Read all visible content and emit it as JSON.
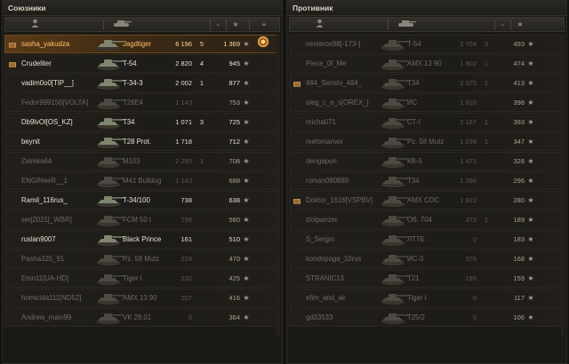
{
  "allies": {
    "title": "Союзники",
    "header": {
      "player_icon": "player-icon",
      "tank_icon": "tank-icon",
      "sort_icon": "sort-chevron-icon",
      "rating_icon": "star-icon",
      "extra_icon": "menu-icon"
    },
    "rows": [
      {
        "player": "sasha_yakudza",
        "tank": "Jagdtiger",
        "num1": "6 196",
        "num2": "5",
        "num3": "1 369",
        "star": "★",
        "clan_badge": true,
        "alive": true,
        "me": true,
        "extra": "achievement-icon"
      },
      {
        "player": "Crudeliter",
        "tank": "T-54",
        "num1": "2 820",
        "num2": "4",
        "num3": "945",
        "star": "★",
        "clan_badge": true,
        "alive": true
      },
      {
        "player": "vadim0o0[TIP__]",
        "tank": "T-34-3",
        "num1": "2 002",
        "num2": "1",
        "num3": "877",
        "star": "★",
        "alive": true
      },
      {
        "player": "Fedor999156[VOLTA]",
        "tank": "T26E4",
        "num1": "1 143",
        "num2": "",
        "num3": "753",
        "star": "★",
        "alive": false
      },
      {
        "player": "Db9lvOl[OS_KZ]",
        "tank": "T34",
        "num1": "1 071",
        "num2": "3",
        "num3": "725",
        "star": "★",
        "alive": true
      },
      {
        "player": "beynit",
        "tank": "T28 Prot.",
        "num1": "1 718",
        "num2": "",
        "num3": "712",
        "star": "★",
        "alive": true
      },
      {
        "player": "Zaimka64",
        "tank": "M103",
        "num1": "2 295",
        "num2": "1",
        "num3": "708",
        "star": "★",
        "alive": false
      },
      {
        "player": "ENGINeeR__1",
        "tank": "M41 Bulldog",
        "num1": "1 143",
        "num2": "",
        "num3": "688",
        "star": "★",
        "alive": false
      },
      {
        "player": "Ramil_116rus_",
        "tank": "T-34/100",
        "num1": "738",
        "num2": "",
        "num3": "638",
        "star": "★",
        "alive": true
      },
      {
        "player": "serj2021[_WBR]",
        "tank": "FCM 50 t",
        "num1": "756",
        "num2": "",
        "num3": "560",
        "star": "★",
        "alive": false
      },
      {
        "player": "ruslan9007",
        "tank": "Black Prince",
        "num1": "161",
        "num2": "",
        "num3": "510",
        "star": "★",
        "alive": true
      },
      {
        "player": "Pasha325_91",
        "tank": "Pz. 58 Mutz",
        "num1": "228",
        "num2": "",
        "num3": "470",
        "star": "★",
        "alive": false
      },
      {
        "player": "Emn11[UA-HD]",
        "tank": "Tiger I",
        "num1": "232",
        "num2": "",
        "num3": "425",
        "star": "★",
        "alive": false
      },
      {
        "player": "homicida111[ND52]",
        "tank": "AMX 13 90",
        "num1": "207",
        "num2": "",
        "num3": "416",
        "star": "★",
        "alive": false
      },
      {
        "player": "Andrew_main99",
        "tank": "VK 28.01",
        "num1": "0",
        "num2": "",
        "num3": "364",
        "star": "★",
        "alive": false
      }
    ]
  },
  "enemies": {
    "title": "Противник",
    "header": {
      "player_icon": "player-icon",
      "tank_icon": "tank-icon",
      "sort_icon": "sort-chevron-icon",
      "rating_icon": "star-icon"
    },
    "rows": [
      {
        "player": "nesteros98[-173-]",
        "tank": "T-54",
        "num1": "2 704",
        "num2": "3",
        "num3": "493",
        "star": "★",
        "alive": false
      },
      {
        "player": "Piece_0f_Me",
        "tank": "AMX 13 90",
        "num1": "1 902",
        "num2": "1",
        "num3": "474",
        "star": "★",
        "alive": false
      },
      {
        "player": "484_Senshi_484_",
        "tank": "T34",
        "num1": "2 375",
        "num2": "1",
        "num3": "413",
        "star": "★",
        "clan_badge": true,
        "alive": false
      },
      {
        "player": "oleg_c_e_s[OREX_]",
        "tank": "ИС",
        "num1": "1 810",
        "num2": "",
        "num3": "398",
        "star": "★",
        "alive": false
      },
      {
        "player": "micha071",
        "tank": "СТ-I",
        "num1": "2 167",
        "num2": "1",
        "num3": "393",
        "star": "★",
        "alive": false
      },
      {
        "player": "melomanwx",
        "tank": "Pz. 58 Mutz",
        "num1": "1 238",
        "num2": "1",
        "num3": "347",
        "star": "★",
        "alive": false
      },
      {
        "player": "dengapon",
        "tank": "КВ-5",
        "num1": "1 471",
        "num2": "",
        "num3": "328",
        "star": "★",
        "alive": false
      },
      {
        "player": "roman080889",
        "tank": "T34",
        "num1": "1 266",
        "num2": "",
        "num3": "296",
        "star": "★",
        "alive": false
      },
      {
        "player": "Doktor_1616[VSPBV]",
        "tank": "AMX CDC",
        "num1": "1 922",
        "num2": "",
        "num3": "280",
        "star": "★",
        "clan_badge": true,
        "alive": false
      },
      {
        "player": "ziolpanzer",
        "tank": "Об. 704",
        "num1": "373",
        "num2": "1",
        "num3": "189",
        "star": "★",
        "alive": false
      },
      {
        "player": "S_Sergio",
        "tank": "ЛТТБ",
        "num1": "0",
        "num2": "",
        "num3": "183",
        "star": "★",
        "alive": false
      },
      {
        "player": "kondopoga_10rus",
        "tank": "ИС-3",
        "num1": "376",
        "num2": "",
        "num3": "168",
        "star": "★",
        "alive": false
      },
      {
        "player": "STRANIC13",
        "tank": "T21",
        "num1": "195",
        "num2": "",
        "num3": "159",
        "star": "★",
        "alive": false
      },
      {
        "player": "efim_and_ak",
        "tank": "Tiger I",
        "num1": "0",
        "num2": "",
        "num3": "117",
        "star": "★",
        "alive": false
      },
      {
        "player": "gd33533",
        "tank": "T25/2",
        "num1": "0",
        "num2": "",
        "num3": "106",
        "star": "★",
        "alive": false
      }
    ]
  },
  "colors": {
    "me_row": "#5a3b17",
    "alive_text": "#e6e1d4",
    "dead_text": "#6e6a61",
    "panel_bg": "#1b1915"
  }
}
